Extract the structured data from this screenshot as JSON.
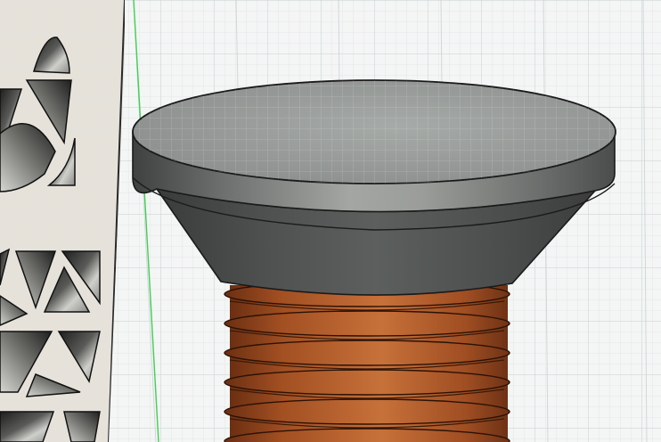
{
  "viewport": {
    "name": "3d-cad-viewport",
    "background": "#f4f5f5",
    "grid": {
      "visible": true,
      "minor_color": "#dfe3e5",
      "major_color": "#c9ced1"
    },
    "axis_color": "#3fcf54"
  },
  "objects": {
    "screw_head": {
      "kind": "countersunk-head",
      "color": "#8e918f"
    },
    "screw_thread": {
      "kind": "threaded-shank",
      "color": "#b25a2c"
    },
    "lattice_panel": {
      "kind": "perforated-panel",
      "color": "#e5e1d9"
    }
  }
}
